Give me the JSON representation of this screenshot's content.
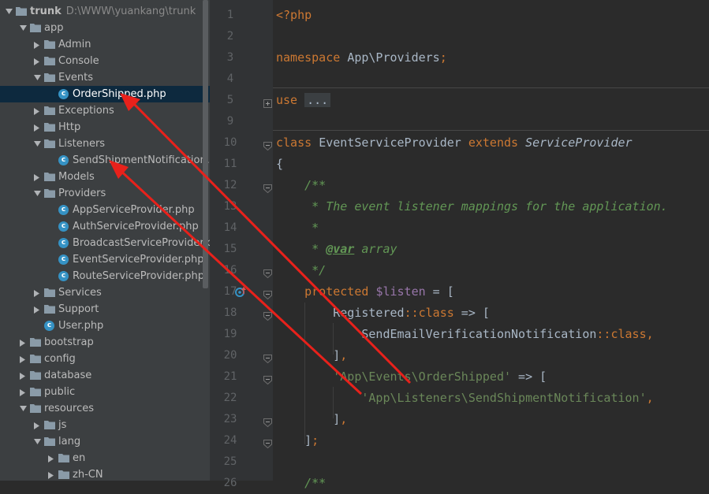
{
  "project_tree": {
    "items": [
      {
        "label": "trunk",
        "path": "D:\\WWW\\yuankang\\trunk",
        "type": "folder",
        "depth": 0,
        "expanded": true,
        "bold": true
      },
      {
        "label": "app",
        "type": "folder",
        "depth": 1,
        "expanded": true
      },
      {
        "label": "Admin",
        "type": "folder",
        "depth": 2,
        "expanded": false
      },
      {
        "label": "Console",
        "type": "folder",
        "depth": 2,
        "expanded": false
      },
      {
        "label": "Events",
        "type": "folder",
        "depth": 2,
        "expanded": true
      },
      {
        "label": "OrderShipped.php",
        "type": "class",
        "depth": 3,
        "selected": true
      },
      {
        "label": "Exceptions",
        "type": "folder",
        "depth": 2,
        "expanded": false
      },
      {
        "label": "Http",
        "type": "folder",
        "depth": 2,
        "expanded": false
      },
      {
        "label": "Listeners",
        "type": "folder",
        "depth": 2,
        "expanded": true
      },
      {
        "label": "SendShipmentNotification.php",
        "type": "class",
        "depth": 3
      },
      {
        "label": "Models",
        "type": "folder",
        "depth": 2,
        "expanded": false
      },
      {
        "label": "Providers",
        "type": "folder",
        "depth": 2,
        "expanded": true
      },
      {
        "label": "AppServiceProvider.php",
        "type": "class",
        "depth": 3
      },
      {
        "label": "AuthServiceProvider.php",
        "type": "class",
        "depth": 3
      },
      {
        "label": "BroadcastServiceProvider.php",
        "type": "class",
        "depth": 3
      },
      {
        "label": "EventServiceProvider.php",
        "type": "class",
        "depth": 3
      },
      {
        "label": "RouteServiceProvider.php",
        "type": "class",
        "depth": 3
      },
      {
        "label": "Services",
        "type": "folder",
        "depth": 2,
        "expanded": false
      },
      {
        "label": "Support",
        "type": "folder",
        "depth": 2,
        "expanded": false
      },
      {
        "label": "User.php",
        "type": "class",
        "depth": 2
      },
      {
        "label": "bootstrap",
        "type": "folder",
        "depth": 1,
        "expanded": false
      },
      {
        "label": "config",
        "type": "folder",
        "depth": 1,
        "expanded": false
      },
      {
        "label": "database",
        "type": "folder",
        "depth": 1,
        "expanded": false
      },
      {
        "label": "public",
        "type": "folder",
        "depth": 1,
        "expanded": false
      },
      {
        "label": "resources",
        "type": "folder",
        "depth": 1,
        "expanded": true
      },
      {
        "label": "js",
        "type": "folder",
        "depth": 2,
        "expanded": false
      },
      {
        "label": "lang",
        "type": "folder",
        "depth": 2,
        "expanded": true
      },
      {
        "label": "en",
        "type": "folder",
        "depth": 3,
        "expanded": false
      },
      {
        "label": "zh-CN",
        "type": "folder",
        "depth": 3,
        "expanded": false
      }
    ]
  },
  "editor": {
    "line_numbers": [
      "1",
      "2",
      "3",
      "4",
      "5",
      "9",
      "10",
      "11",
      "12",
      "13",
      "14",
      "15",
      "16",
      "17",
      "18",
      "19",
      "20",
      "21",
      "22",
      "23",
      "24",
      "25",
      "26"
    ],
    "lines": [
      [
        {
          "t": "<?php",
          "c": "kw"
        }
      ],
      [],
      [
        {
          "t": "namespace ",
          "c": "kw"
        },
        {
          "t": "App\\Providers"
        },
        {
          "t": ";",
          "c": "kw"
        }
      ],
      [],
      [
        {
          "t": "use ",
          "c": "kw"
        },
        {
          "t": "...",
          "c": "fold-text"
        }
      ],
      [],
      [
        {
          "t": "class ",
          "c": "kw"
        },
        {
          "t": "EventServiceProvider "
        },
        {
          "t": "extends ",
          "c": "kw"
        },
        {
          "t": "ServiceProvider",
          "c": "it"
        }
      ],
      [
        {
          "t": "{"
        }
      ],
      [
        {
          "t": "    /**",
          "c": "cmt"
        }
      ],
      [
        {
          "t": "     * The event listener mappings for the application.",
          "c": "cmt"
        }
      ],
      [
        {
          "t": "     *",
          "c": "cmt"
        }
      ],
      [
        {
          "t": "     * ",
          "c": "cmt"
        },
        {
          "t": "@var",
          "c": "tag"
        },
        {
          "t": " array",
          "c": "cmt"
        }
      ],
      [
        {
          "t": "     */",
          "c": "cmt"
        }
      ],
      [
        {
          "t": "    protected ",
          "c": "kw"
        },
        {
          "t": "$listen",
          "c": "var"
        },
        {
          "t": " = ["
        }
      ],
      [
        {
          "t": "        Registered"
        },
        {
          "t": "::",
          "c": "kw"
        },
        {
          "t": "class",
          "c": "kw"
        },
        {
          "t": " => ["
        }
      ],
      [
        {
          "t": "            SendEmailVerificationNotification"
        },
        {
          "t": "::",
          "c": "kw"
        },
        {
          "t": "class",
          "c": "kw"
        },
        {
          "t": ",",
          "c": "kw"
        }
      ],
      [
        {
          "t": "        ]"
        },
        {
          "t": ",",
          "c": "kw"
        }
      ],
      [
        {
          "t": "        "
        },
        {
          "t": "'App\\Events\\OrderShipped'",
          "c": "str"
        },
        {
          "t": " => ["
        }
      ],
      [
        {
          "t": "            "
        },
        {
          "t": "'App\\Listeners\\SendShipmentNotification'",
          "c": "str"
        },
        {
          "t": ",",
          "c": "kw"
        }
      ],
      [
        {
          "t": "        ]"
        },
        {
          "t": ",",
          "c": "kw"
        }
      ],
      [
        {
          "t": "    ]"
        },
        {
          "t": ";",
          "c": "kw"
        }
      ],
      [],
      [
        {
          "t": "    /**",
          "c": "cmt"
        }
      ]
    ]
  },
  "colors": {
    "annotation_arrow": "#e8211b",
    "folder": "#8a9ba8",
    "class_icon": "#3592c4",
    "selection": "#0d293e"
  }
}
